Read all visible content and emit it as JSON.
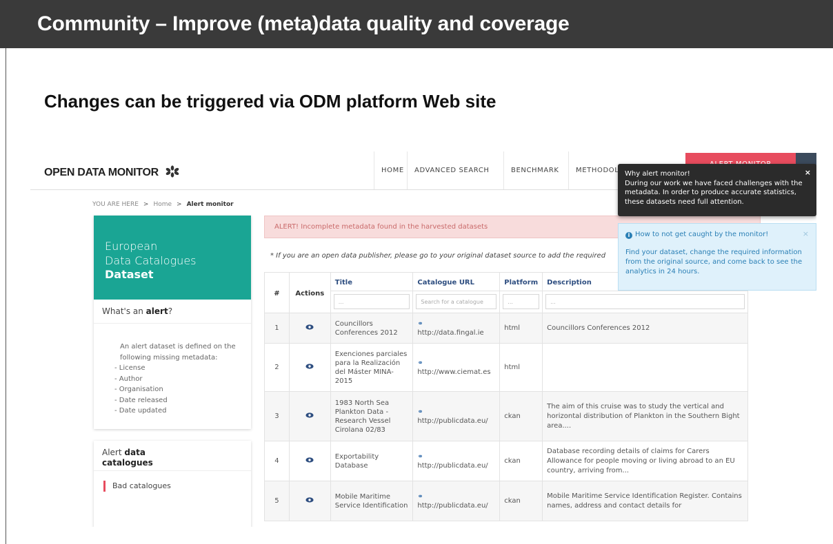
{
  "slide": {
    "title": "Community – Improve (meta)data quality and coverage",
    "subtitle": "Changes can be triggered via ODM platform Web site"
  },
  "site": {
    "logo": "OPEN DATA MONITOR",
    "nav": [
      "HOME",
      "ADVANCED SEARCH",
      "BENCHMARK",
      "METHODOLOGY",
      "ALERT MONITOR"
    ],
    "breadcrumb": {
      "prefix": "YOU ARE HERE",
      "home": "Home",
      "current": "Alert monitor"
    }
  },
  "sidebar": {
    "hero": {
      "line1": "European",
      "line2": "Data Catalogues",
      "line3": "Dataset"
    },
    "question_pre": "What's an ",
    "question_bold": "alert",
    "question_post": "?",
    "intro": "An alert dataset is defined on the following missing metadata:",
    "items": [
      "- License",
      "- Author",
      "- Organisation",
      "- Date released",
      "- Date updated"
    ],
    "card2_pre": "Alert ",
    "card2_bold": "data",
    "card2_post": "catalogues",
    "bad_catalogues": "Bad catalogues"
  },
  "alert_text": "ALERT! Incomplete metadata found in the harvested datasets",
  "note": "* If you are an open data publisher, please go to your original dataset source to add the required",
  "table": {
    "headers": {
      "num": "#",
      "actions": "Actions",
      "title": "Title",
      "url": "Catalogue URL",
      "platform": "Platform",
      "description": "Description"
    },
    "placeholders": {
      "title": "...",
      "url": "Search for a catalogue",
      "platform": "...",
      "description": "..."
    },
    "rows": [
      {
        "num": "1",
        "title": "Councillors Conferences 2012",
        "url": "http://data.fingal.ie",
        "platform": "html",
        "description": "Councillors Conferences 2012"
      },
      {
        "num": "2",
        "title": "Exenciones parciales para la Realización del Máster MINA-2015",
        "url": "http://www.ciemat.es",
        "platform": "html",
        "description": ""
      },
      {
        "num": "3",
        "title": "1983 North Sea Plankton Data - Research Vessel Cirolana 02/83",
        "url": "http://publicdata.eu/",
        "platform": "ckan",
        "description": "The aim of this cruise was to study the vertical and horizontal distribution of Plankton in the Southern Bight area...."
      },
      {
        "num": "4",
        "title": "Exportability Database",
        "url": "http://publicdata.eu/",
        "platform": "ckan",
        "description": "Database recording details of claims for Carers Allowance for people moving or living abroad to an EU country, arriving from..."
      },
      {
        "num": "5",
        "title": "Mobile Maritime Service Identification",
        "url": "http://publicdata.eu/",
        "platform": "ckan",
        "description": "Mobile Maritime Service Identification Register. Contains names, address and contact details for"
      }
    ]
  },
  "tooltip": {
    "title": "Why alert monitor!",
    "body": "During our work we have faced challenges with the metadata. In order to produce accurate statistics, these datasets need full attention.",
    "close": "×"
  },
  "info": {
    "icon": "i",
    "title": "How to not get caught by the monitor!",
    "body": "Find your dataset, change the required information from the original source, and come back to see the analytics in 24 hours.",
    "close": "×"
  },
  "colors": {
    "teal": "#1aa594",
    "alert_red": "#e74c5e",
    "link_blue": "#2f6aa9",
    "header_dark": "#3a3a3a"
  }
}
